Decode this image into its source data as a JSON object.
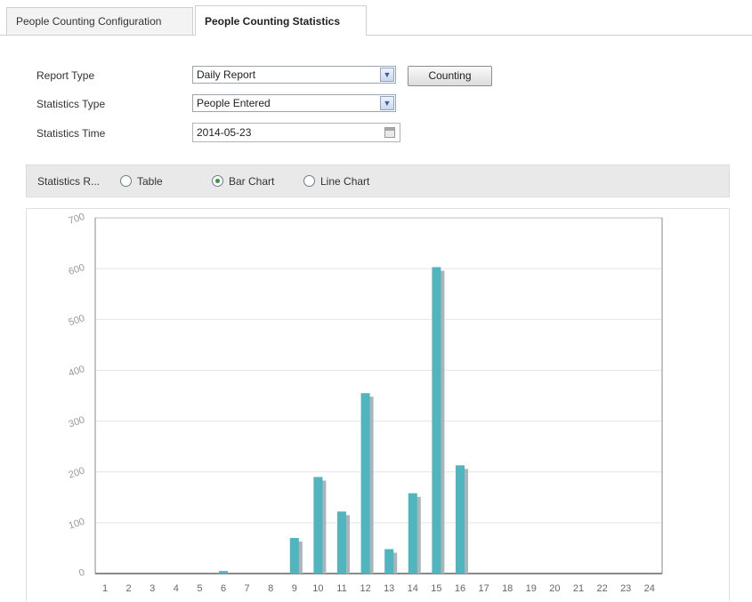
{
  "tabs": [
    {
      "label": "People Counting Configuration",
      "active": false
    },
    {
      "label": "People Counting Statistics",
      "active": true
    }
  ],
  "form": {
    "report_type_label": "Report Type",
    "report_type_value": "Daily Report",
    "statistics_type_label": "Statistics Type",
    "statistics_type_value": "People Entered",
    "statistics_time_label": "Statistics Time",
    "statistics_time_value": "2014-05-23",
    "counting_button": "Counting"
  },
  "display": {
    "label": "Statistics R...",
    "options": [
      {
        "label": "Table",
        "selected": false
      },
      {
        "label": "Bar Chart",
        "selected": true
      },
      {
        "label": "Line Chart",
        "selected": false
      }
    ]
  },
  "colors": {
    "bar": "#4fb5bf",
    "bar_shadow": "#a9b5b9",
    "radio_selected": "#2e9a3a"
  },
  "chart_data": {
    "type": "bar",
    "categories": [
      "1",
      "2",
      "3",
      "4",
      "5",
      "6",
      "7",
      "8",
      "9",
      "10",
      "11",
      "12",
      "13",
      "14",
      "15",
      "16",
      "17",
      "18",
      "19",
      "20",
      "21",
      "22",
      "23",
      "24"
    ],
    "values": [
      0,
      0,
      0,
      0,
      0,
      5,
      0,
      0,
      70,
      190,
      122,
      355,
      48,
      158,
      603,
      213,
      0,
      0,
      0,
      0,
      0,
      0,
      0,
      0
    ],
    "yticks": [
      "0",
      "100",
      "200",
      "300",
      "400",
      "500",
      "600",
      "700"
    ],
    "ylim": [
      0,
      700
    ],
    "grid": true,
    "legend": false
  }
}
